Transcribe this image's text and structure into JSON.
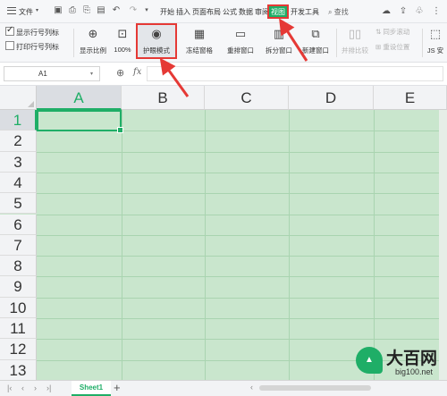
{
  "menubar": {
    "file_label": "文件",
    "tabs": [
      "开始",
      "插入",
      "页面布局",
      "公式",
      "数据",
      "审阅",
      "视图",
      "开发工具"
    ],
    "active_tab": "视图",
    "search_label": "查找"
  },
  "ribbon": {
    "show_rowcol_label": "显示行号列标",
    "show_rowcol_checked": true,
    "print_rowcol_label": "打印行号列标",
    "print_rowcol_checked": false,
    "buttons": {
      "zoom": "显示比例",
      "zoom100": "100%",
      "eye_mode": "护眼模式",
      "freeze": "冻结窗格",
      "rearrange": "重排窗口",
      "split": "拆分窗口",
      "new_window": "新建窗口",
      "side_by_side": "并排比较",
      "sync_scroll": "同步滚动",
      "reset_position": "重设位置",
      "js": "JS 安"
    }
  },
  "formula_bar": {
    "cell_ref": "A1",
    "fx": "fx",
    "value": ""
  },
  "grid": {
    "columns": [
      "A",
      "B",
      "C",
      "D",
      "E"
    ],
    "rows": [
      "1",
      "2",
      "3",
      "4",
      "5",
      "6",
      "7",
      "8",
      "9",
      "10",
      "11",
      "12",
      "13"
    ],
    "selected_cell": "A1",
    "background_color": "#c9e6cd",
    "accent_color": "#1fae67"
  },
  "sheetbar": {
    "sheet_name": "Sheet1",
    "add_label": "+"
  },
  "watermark": {
    "title": "大百网",
    "url": "big100.net"
  },
  "colors": {
    "highlight_red": "#e53935",
    "active_green": "#1fae67"
  }
}
